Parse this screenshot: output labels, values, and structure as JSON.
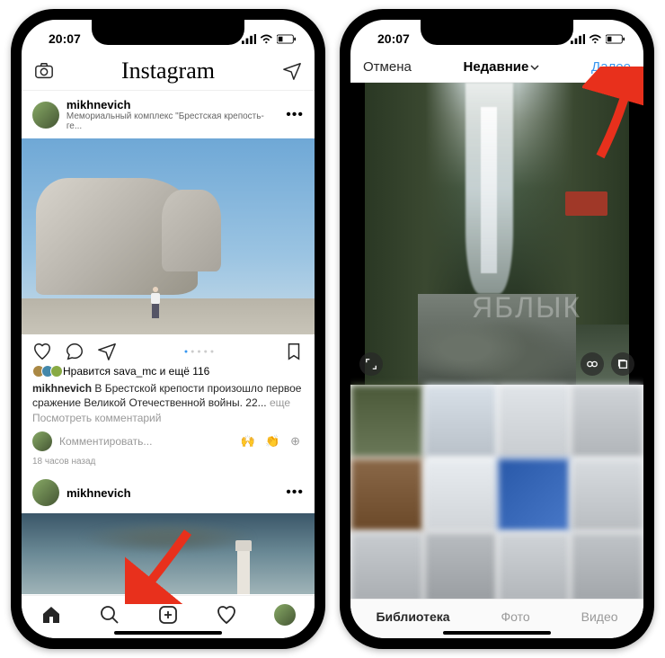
{
  "status": {
    "time": "20:07"
  },
  "screen1": {
    "header_logo": "Instagram",
    "post": {
      "username": "mikhnevich",
      "location": "Мемориальный комплекс \"Брестская крепость-ге...",
      "likes_text": "Нравится sava_mc и ещё 116",
      "caption_user": "mikhnevich",
      "caption_text": " В Брестской крепости произошло первое сражение Великой Отечественной войны. 22... ",
      "caption_more": "еще",
      "view_comments": "Посмотреть комментарий",
      "comment_placeholder": "Комментировать...",
      "comment_emoji": "🙌 👏 ⊕",
      "timestamp": "18 часов назад"
    },
    "next_post_user": "mikhnevich"
  },
  "screen2": {
    "cancel": "Отмена",
    "title": "Недавние",
    "next": "Далее",
    "tabs": {
      "library": "Библиотека",
      "photo": "Фото",
      "video": "Видео"
    }
  }
}
